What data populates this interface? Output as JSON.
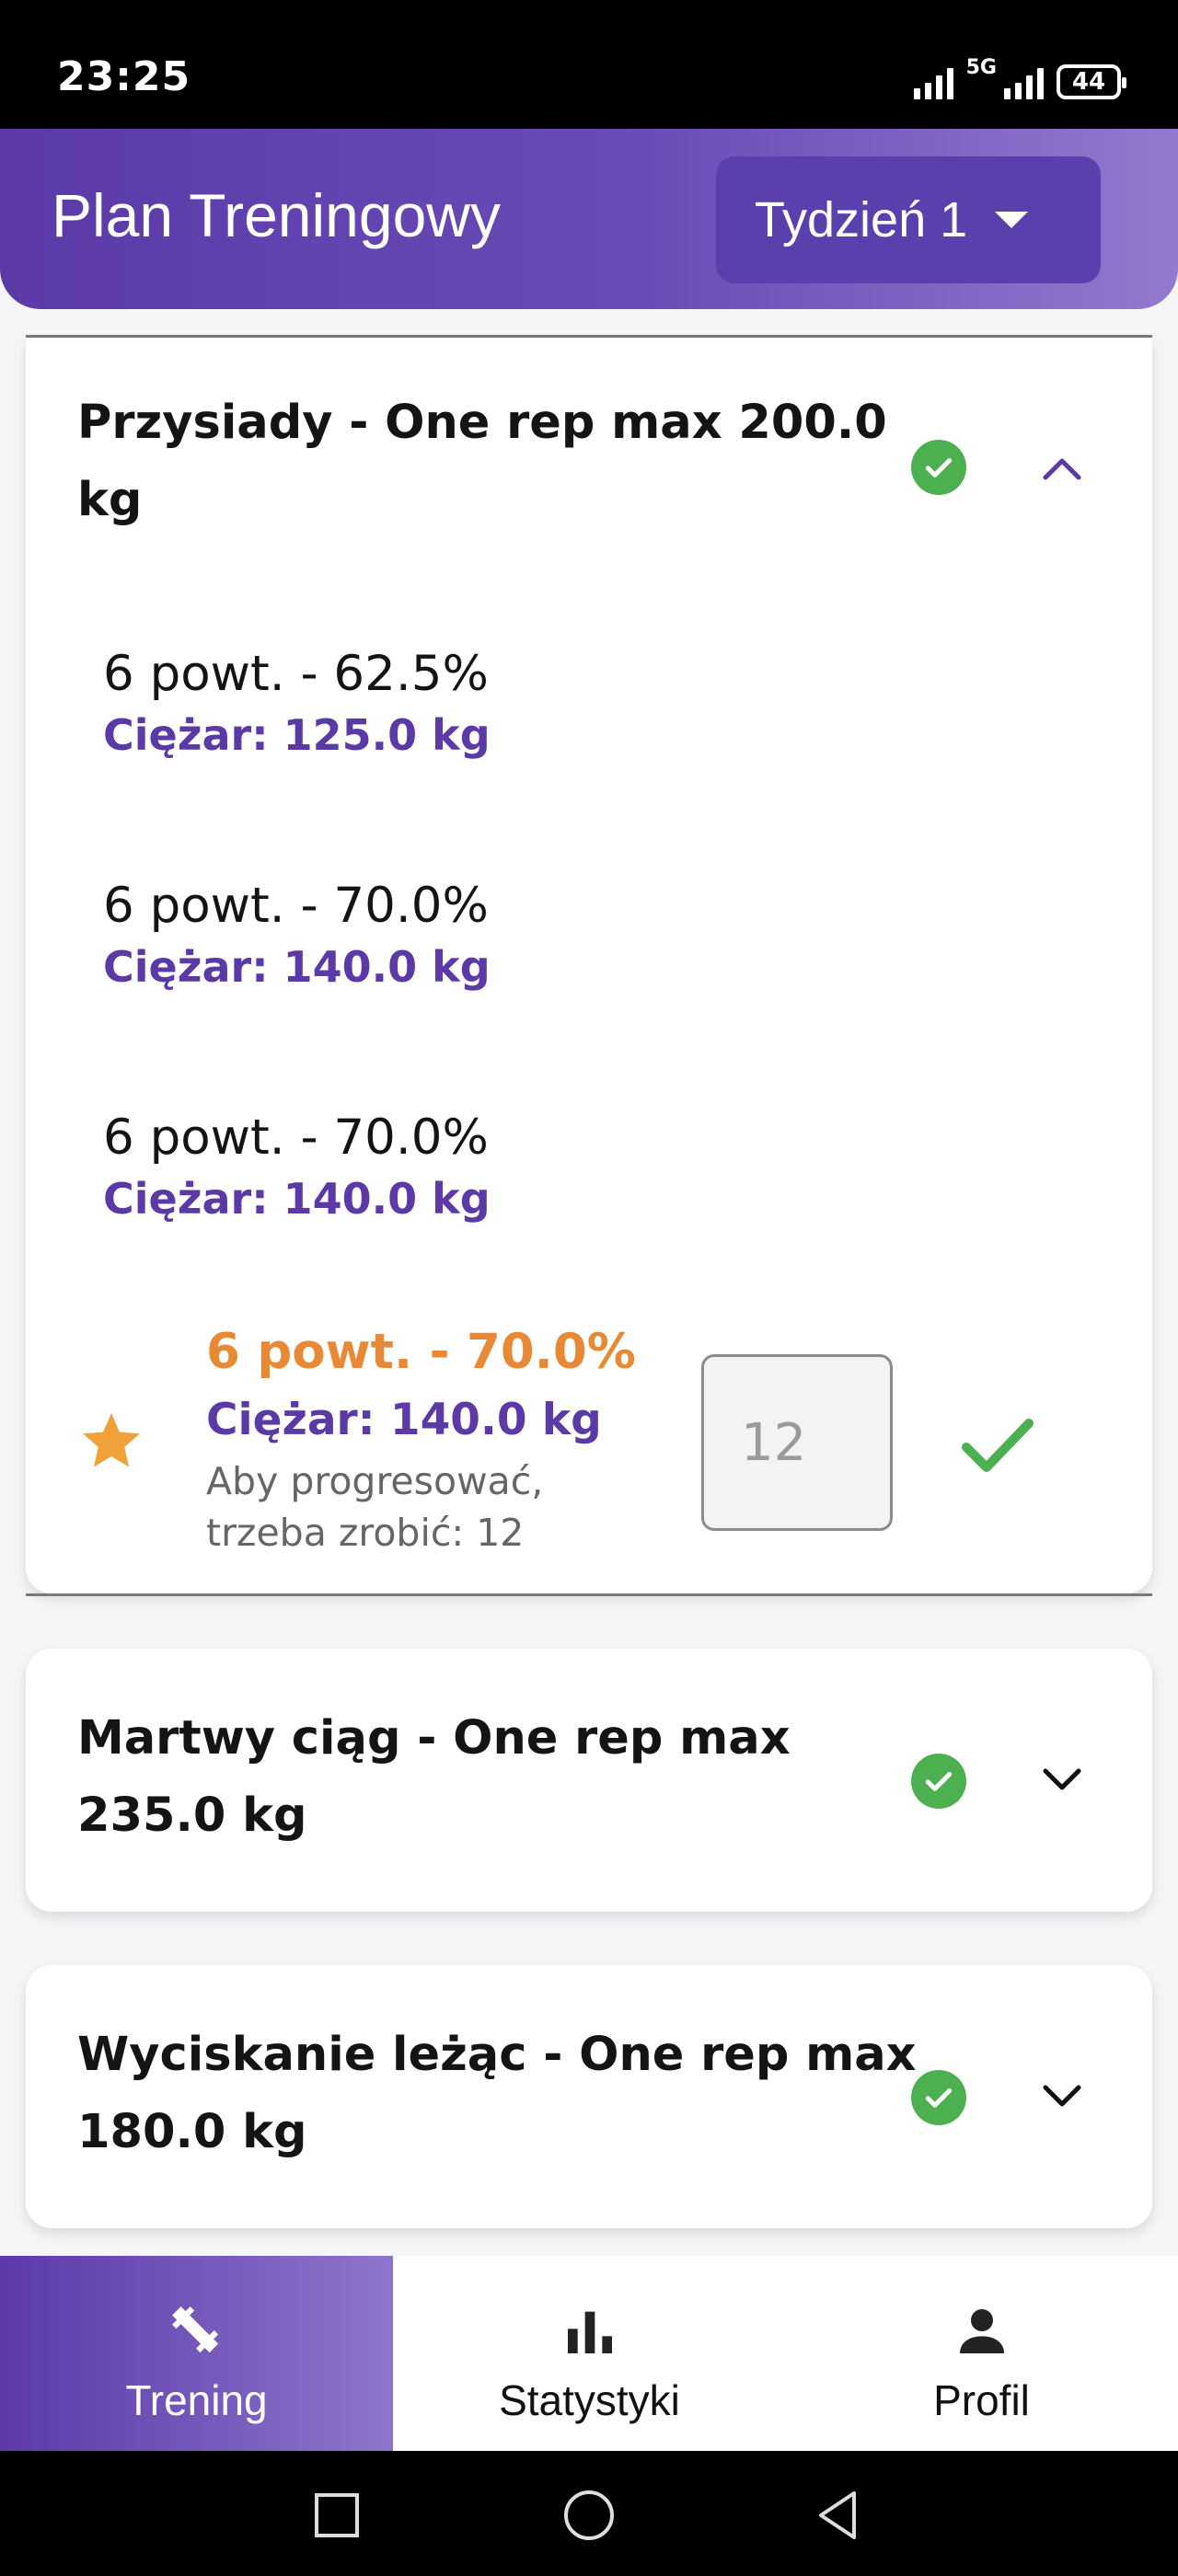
{
  "status_bar": {
    "time": "23:25",
    "network": "5G",
    "battery": "44"
  },
  "header": {
    "title": "Plan Treningowy",
    "week": "Tydzień 1"
  },
  "exercises": [
    {
      "title": "Przysiady - One rep max 200.0 kg",
      "expanded": true,
      "done": true,
      "sets": [
        {
          "reps": "6 powt. - 62.5%",
          "weight": "Ciężar: 125.0 kg"
        },
        {
          "reps": "6 powt. - 70.0%",
          "weight": "Ciężar: 140.0 kg"
        },
        {
          "reps": "6 powt. - 70.0%",
          "weight": "Ciężar: 140.0 kg"
        }
      ],
      "current_set": {
        "reps": "6 powt. - 70.0%",
        "weight": "Ciężar: 140.0 kg",
        "hint": "Aby progresować, trzeba zrobić: 12",
        "input_placeholder": "12"
      }
    },
    {
      "title": "Martwy ciąg - One rep max 235.0 kg",
      "expanded": false,
      "done": true
    },
    {
      "title": "Wyciskanie leżąc - One rep max 180.0 kg",
      "expanded": false,
      "done": true
    }
  ],
  "bottom_nav": [
    {
      "label": "Trening",
      "icon": "dumbbell-icon",
      "active": true
    },
    {
      "label": "Statystyki",
      "icon": "bar-chart-icon",
      "active": false
    },
    {
      "label": "Profil",
      "icon": "person-icon",
      "active": false
    }
  ],
  "colors": {
    "primary": "#5b3aa8",
    "accent": "#e88a35",
    "success": "#4caf50"
  }
}
